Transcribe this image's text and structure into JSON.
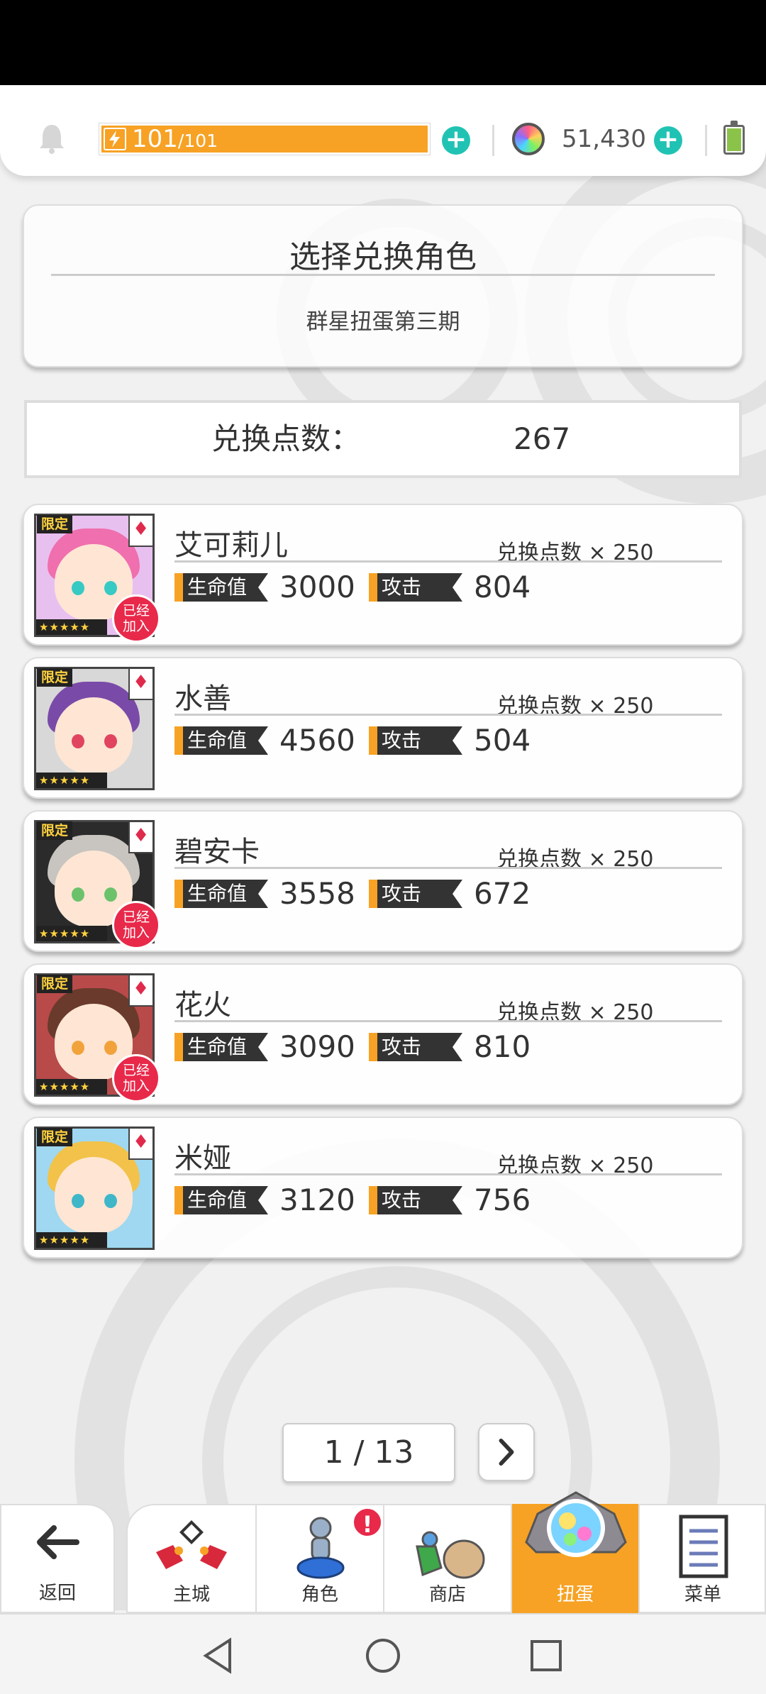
{
  "header": {
    "stamina_current": "101",
    "stamina_max": "/101",
    "gems": "51,430"
  },
  "title_card": {
    "title": "选择兑换角色",
    "subtitle": "群星扭蛋第三期"
  },
  "points": {
    "label": "兑换点数：",
    "value": "267"
  },
  "labels": {
    "limited": "限定",
    "joined_line1": "已经",
    "joined_line2": "加入",
    "hp": "生命值",
    "atk": "攻击",
    "stars": "★★★★★"
  },
  "characters": [
    {
      "name": "艾可莉儿",
      "cost": "兑换点数 × 250",
      "hp": "3000",
      "atk": "804",
      "joined": true,
      "hair": "#f06fae",
      "eyes": [
        "#37c9c3",
        "#37c9c3"
      ],
      "bg": "#e8c0f0"
    },
    {
      "name": "水善",
      "cost": "兑换点数 × 250",
      "hp": "4560",
      "atk": "504",
      "joined": false,
      "hair": "#7a4aa8",
      "eyes": [
        "#e0445e",
        "#e0445e"
      ],
      "bg": "#d8d8d8"
    },
    {
      "name": "碧安卡",
      "cost": "兑换点数 × 250",
      "hp": "3558",
      "atk": "672",
      "joined": true,
      "hair": "#c8c4c0",
      "eyes": [
        "#6bc26b",
        "#6bc26b"
      ],
      "bg": "#2b2b2b"
    },
    {
      "name": "花火",
      "cost": "兑换点数 × 250",
      "hp": "3090",
      "atk": "810",
      "joined": true,
      "hair": "#6a3a2c",
      "eyes": [
        "#f2a23a",
        "#f2a23a"
      ],
      "bg": "#b84a4a"
    },
    {
      "name": "米娅",
      "cost": "兑换点数 × 250",
      "hp": "3120",
      "atk": "756",
      "joined": false,
      "hair": "#f2c24a",
      "eyes": [
        "#3fb7c8",
        "#3fb7c8"
      ],
      "bg": "#9fd8f0"
    }
  ],
  "pager": {
    "text": "1 / 13"
  },
  "nav": {
    "back": "返回",
    "tabs": [
      "主城",
      "角色",
      "商店",
      "扭蛋",
      "菜单"
    ],
    "active_tab": "扭蛋",
    "badge": "!"
  },
  "colors": {
    "accent": "#f7a224",
    "plus": "#20c3b3",
    "badge": "#e8294a"
  }
}
